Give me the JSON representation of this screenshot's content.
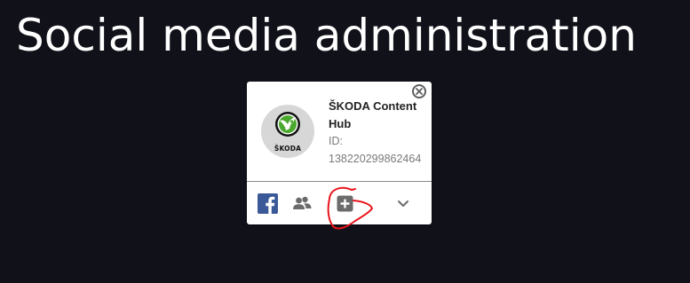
{
  "page": {
    "title": "Social media administration"
  },
  "account": {
    "name": "ŠKODA Content Hub",
    "id_label": "ID:",
    "id_value": "138220299862464",
    "logo_text": "ŠKODA"
  },
  "actions": [
    {
      "name": "facebook",
      "icon": "facebook-icon"
    },
    {
      "name": "users",
      "icon": "people-icon"
    },
    {
      "name": "add",
      "icon": "plus-square-icon"
    },
    {
      "name": "expand",
      "icon": "chevron-down-icon"
    }
  ],
  "colors": {
    "background": "#11111a",
    "card": "#ffffff",
    "facebook": "#3b5998",
    "icon_gray": "#6b6b6b",
    "skoda_green": "#4ba82e",
    "annotation_red": "#e8141b"
  }
}
